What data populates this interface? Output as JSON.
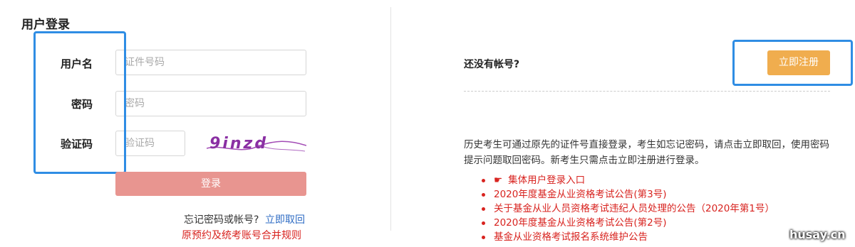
{
  "login": {
    "title": "用户登录",
    "username_label": "用户名",
    "username_placeholder": "证件号码",
    "password_label": "密码",
    "password_placeholder": "密码",
    "captcha_label": "验证码",
    "captcha_placeholder": "验证码",
    "captcha_text": "9inzd",
    "submit_label": "登录",
    "forgot_text": "忘记密码或帐号?",
    "forgot_link": "立即取回",
    "rule_link": "原预约及统考账号合并规则"
  },
  "register": {
    "prompt": "还没有帐号?",
    "button_label": "立即注册",
    "description": "历史考生可通过原先的证件号直接登录，考生如忘记密码，请点击立即取回，使用密码提示问题取回密码。新考生只需点击立即注册进行登录。"
  },
  "notices": [
    {
      "icon": "pointing-hand-icon",
      "text": "集体用户登录入口"
    },
    {
      "text": "2020年度基金从业资格考试公告(第3号)"
    },
    {
      "text": "关于基金从业人员资格考试违纪人员处理的公告（2020年第1号）"
    },
    {
      "text": "2020年度基金从业资格考试公告(第2号)"
    },
    {
      "text": "基金从业资格考试报名系统维护公告"
    }
  ],
  "watermark": "husay.cn",
  "colors": {
    "highlight": "#2f8de4",
    "login_button": "#e89590",
    "register_button": "#f0ad4e",
    "notice_red": "#d8231f",
    "link_blue": "#2f6cc4"
  }
}
